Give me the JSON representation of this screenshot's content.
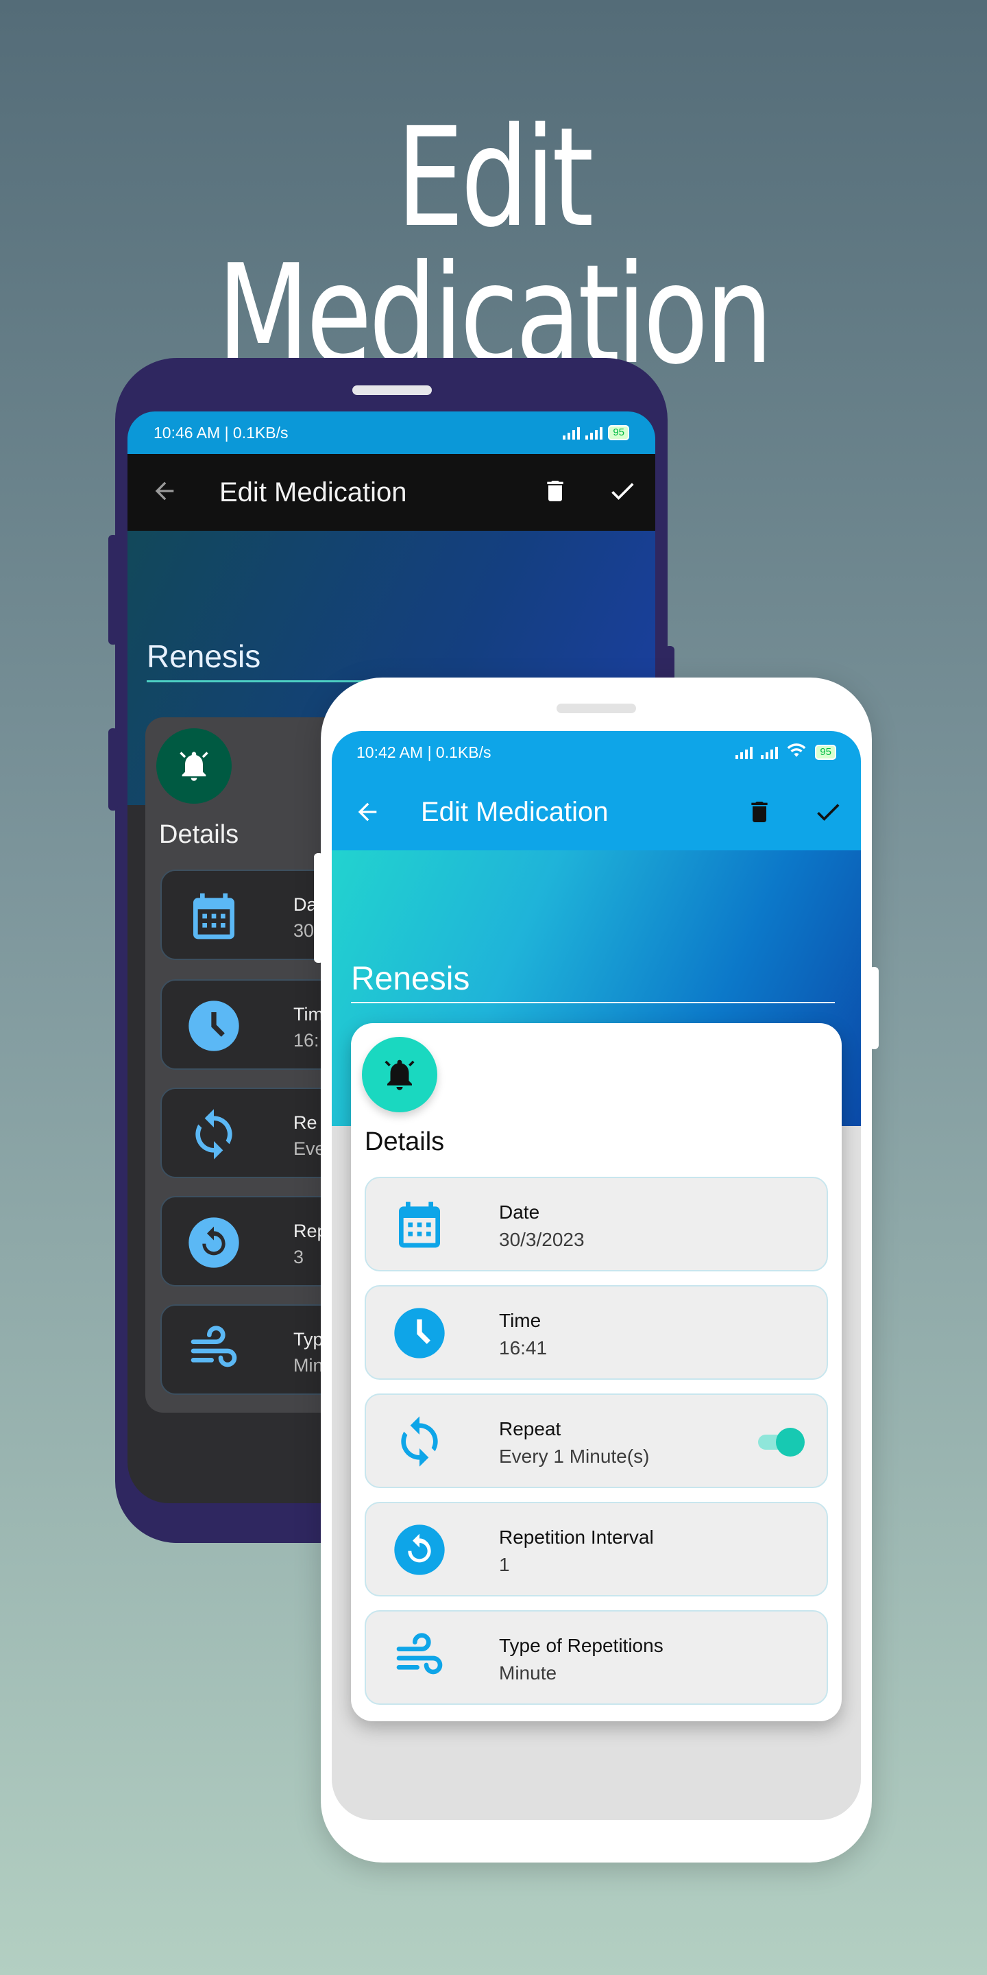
{
  "headline": "Edit Medication",
  "dark_phone": {
    "status_left": "10:46 AM | 0.1KB/s",
    "battery": "95",
    "title": "Edit Medication",
    "med_name": "Renesis",
    "details_label": "Details",
    "rows": [
      {
        "icon": "calendar-icon",
        "label": "Da",
        "value": "30"
      },
      {
        "icon": "clock-icon",
        "label": "Tim",
        "value": "16:"
      },
      {
        "icon": "repeat-icon",
        "label": "Re",
        "value": "Eve"
      },
      {
        "icon": "replay-icon",
        "label": "Rep",
        "value": "3"
      },
      {
        "icon": "wind-icon",
        "label": "Typ",
        "value": "Min"
      }
    ]
  },
  "phone": {
    "status_left": "10:42 AM | 0.1KB/s",
    "battery": "95",
    "app_bar": {
      "title": "Edit Medication",
      "back_icon": "arrow-back-icon",
      "delete_icon": "trash-icon",
      "save_icon": "check-icon"
    },
    "med_name": "Renesis",
    "details_label": "Details",
    "rows": [
      {
        "icon": "calendar-icon",
        "label": "Date",
        "value": "30/3/2023"
      },
      {
        "icon": "clock-icon",
        "label": "Time",
        "value": "16:41"
      },
      {
        "icon": "repeat-icon",
        "label": "Repeat",
        "value": "Every 1 Minute(s)",
        "toggle_on": true
      },
      {
        "icon": "replay-icon",
        "label": "Repetition Interval",
        "value": "1"
      },
      {
        "icon": "wind-icon",
        "label": "Type of Repetitions",
        "value": "Minute"
      }
    ]
  },
  "colors": {
    "accent": "#0ea5e8",
    "fab": "#1ad8c0",
    "icon_blue": "#0ea5e8",
    "dark_icon": "#5bb8f5",
    "dark_fab": "#005a42"
  }
}
